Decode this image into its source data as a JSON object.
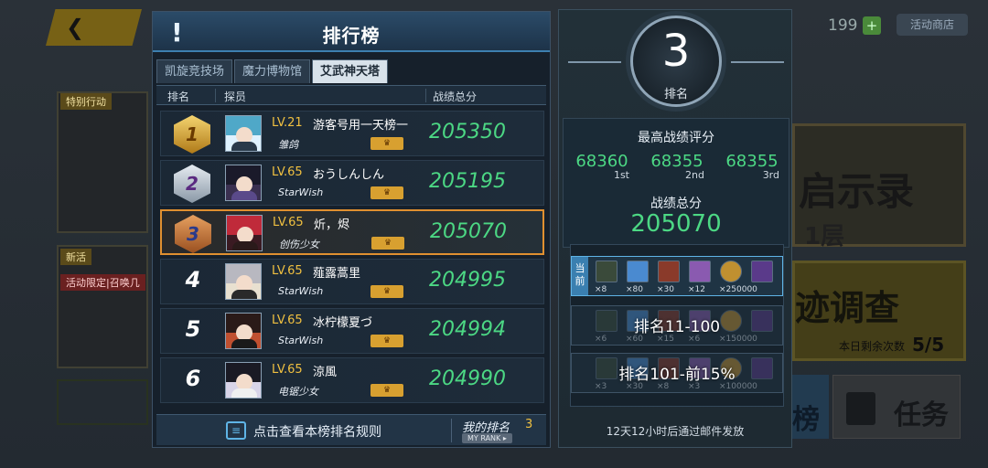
{
  "background": {
    "currency_amount": "199",
    "shop_button": "活动商店",
    "apocalypse_title": "启示录",
    "apocalypse_floor": "1层",
    "investigation_title": "迹调查",
    "investigation_remaining_label": "本日剩余次数",
    "investigation_remaining_value": "5/5",
    "ranking_partial": "榜",
    "task_button": "任务",
    "left_tag_1": "特别行动",
    "left_tag_2": "新活",
    "left_banner": "活动限定|召唤几"
  },
  "leaderboard": {
    "title": "排行榜",
    "tabs": [
      "凯旋竞技场",
      "魔力博物馆",
      "艾武神天塔"
    ],
    "active_tab": "艾武神天塔",
    "columns": {
      "rank": "排名",
      "player": "探员",
      "score": "战绩总分"
    },
    "rows": [
      {
        "rank": "1",
        "level": "LV.21",
        "name": "游客号用一天榜一",
        "guild": "雏鸽",
        "score": "205350",
        "medal": "gold"
      },
      {
        "rank": "2",
        "level": "LV.65",
        "name": "おうしんしん",
        "guild": "StarWish",
        "score": "205195",
        "medal": "silver"
      },
      {
        "rank": "3",
        "level": "LV.65",
        "name": "炘，烬",
        "guild": "创伤少女",
        "score": "205070",
        "medal": "bronze"
      },
      {
        "rank": "4",
        "level": "LV.65",
        "name": "薤露蒿里",
        "guild": "StarWish",
        "score": "204995",
        "medal": ""
      },
      {
        "rank": "5",
        "level": "LV.65",
        "name": "冰柠檬夏づ",
        "guild": "StarWish",
        "score": "204994",
        "medal": ""
      },
      {
        "rank": "6",
        "level": "LV.65",
        "name": "涼風",
        "guild": "电锯少女",
        "score": "204990",
        "medal": ""
      }
    ],
    "footer": {
      "rules_link": "点击查看本榜排名规则",
      "my_rank_label": "我的排名",
      "my_rank_value": "3",
      "my_rank_en": "MY RANK ▸"
    }
  },
  "summary": {
    "rank_value": "3",
    "rank_label": "排名",
    "best_title": "最高战绩评分",
    "best_scores": [
      {
        "value": "68360",
        "ordinal": "1st"
      },
      {
        "value": "68355",
        "ordinal": "2nd"
      },
      {
        "value": "68355",
        "ordinal": "3rd"
      }
    ],
    "total_label": "战绩总分",
    "total_value": "205070",
    "current_tag": "当前",
    "reward_tiers": [
      {
        "label": "",
        "quantities": [
          "×8",
          "×80",
          "×30",
          "×12",
          "×250000",
          ""
        ]
      },
      {
        "label": "排名11-100",
        "quantities": [
          "×6",
          "×60",
          "×15",
          "×6",
          "×150000",
          ""
        ]
      },
      {
        "label": "排名101-前15%",
        "quantities": [
          "×3",
          "×30",
          "×8",
          "×3",
          "×100000",
          ""
        ]
      }
    ],
    "mail_note": "12天12小时后通过邮件发放"
  }
}
